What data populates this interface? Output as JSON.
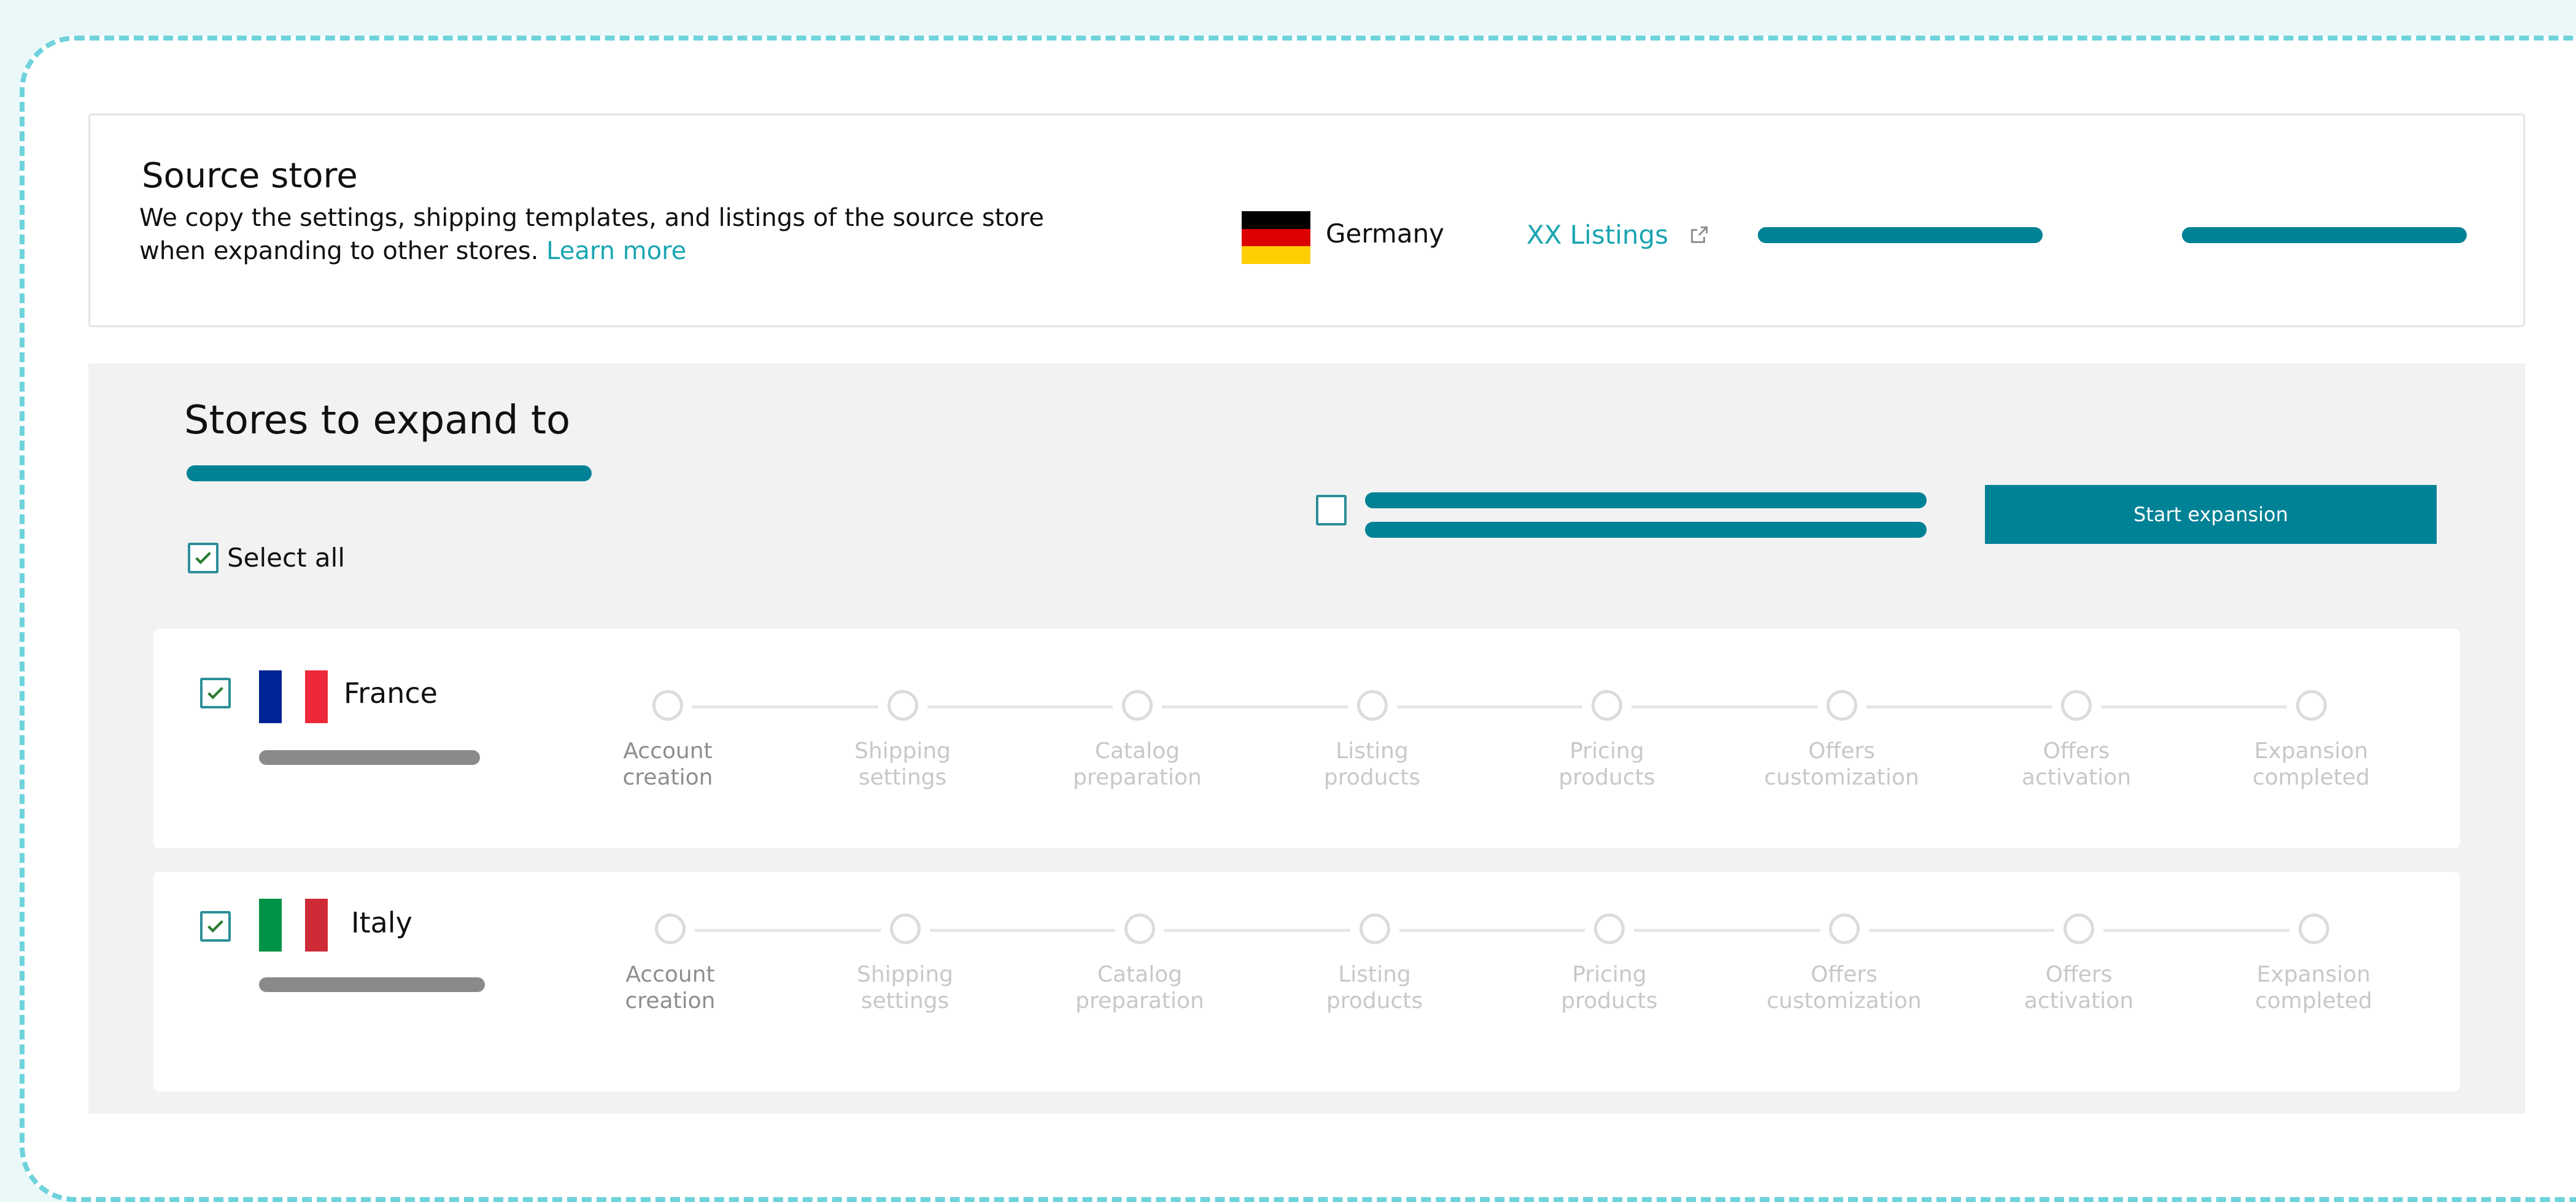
{
  "source_store": {
    "title": "Source store",
    "description": "We copy the settings, shipping templates, and listings of the source store when expanding to other stores.",
    "learn_more": "Learn more",
    "country": "Germany",
    "listings_link": "XX Listings"
  },
  "stores": {
    "title": "Stores to expand to",
    "select_all_label": "Select all",
    "select_all_checked": true,
    "confirm_checked": false,
    "start_button": "Start expansion",
    "countries": [
      {
        "name": "France",
        "checked": true,
        "steps": [
          {
            "line1": "Account",
            "line2": "creation"
          },
          {
            "line1": "Shipping",
            "line2": "settings"
          },
          {
            "line1": "Catalog",
            "line2": "preparation"
          },
          {
            "line1": "Listing",
            "line2": "products"
          },
          {
            "line1": "Pricing",
            "line2": "products"
          },
          {
            "line1": "Offers",
            "line2": "customization"
          },
          {
            "line1": "Offers",
            "line2": "activation"
          },
          {
            "line1": "Expansion",
            "line2": "completed"
          }
        ]
      },
      {
        "name": "Italy",
        "checked": true,
        "steps": [
          {
            "line1": "Account",
            "line2": "creation"
          },
          {
            "line1": "Shipping",
            "line2": "settings"
          },
          {
            "line1": "Catalog",
            "line2": "preparation"
          },
          {
            "line1": "Listing",
            "line2": "products"
          },
          {
            "line1": "Pricing",
            "line2": "products"
          },
          {
            "line1": "Offers",
            "line2": "customization"
          },
          {
            "line1": "Offers",
            "line2": "activation"
          },
          {
            "line1": "Expansion",
            "line2": "completed"
          }
        ]
      }
    ]
  },
  "colors": {
    "accent": "#008296",
    "link": "#1aa5b2",
    "border_dashed": "#6fd3dc",
    "placeholder_gray": "#8a8a8a"
  }
}
